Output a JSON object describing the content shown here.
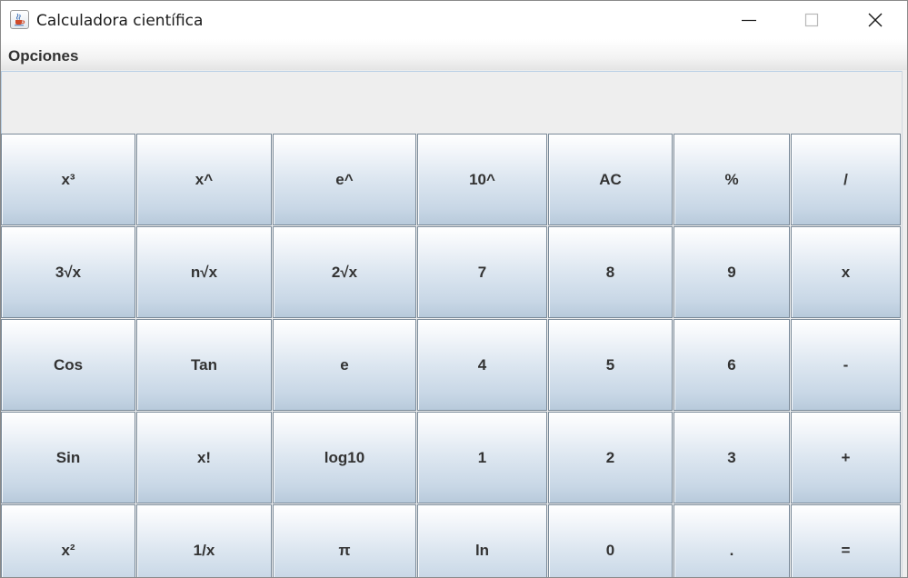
{
  "window": {
    "title": "Calculadora científica",
    "icon": "java-coffee-cup-icon",
    "controls": [
      "minimize-icon",
      "maximize-icon",
      "close-icon"
    ]
  },
  "menu": {
    "items": [
      "Opciones"
    ]
  },
  "display": {
    "value": ""
  },
  "keypad": {
    "rows": [
      [
        "x³",
        "x^",
        "e^",
        "10^",
        "AC",
        "%",
        "/"
      ],
      [
        "3√x",
        "n√x",
        "2√x",
        "7",
        "8",
        "9",
        "x"
      ],
      [
        "Cos",
        "Tan",
        "e",
        "4",
        "5",
        "6",
        "-"
      ],
      [
        "Sin",
        "x!",
        "log10",
        "1",
        "2",
        "3",
        "+"
      ],
      [
        "x²",
        "1/x",
        "π",
        "ln",
        "0",
        ".",
        "="
      ]
    ],
    "names": [
      [
        "key-cube",
        "key-power",
        "key-exp",
        "key-pow10",
        "key-all-clear",
        "key-percent",
        "key-divide"
      ],
      [
        "key-cube-root",
        "key-nth-root",
        "key-square-root",
        "key-7",
        "key-8",
        "key-9",
        "key-multiply"
      ],
      [
        "key-cos",
        "key-tan",
        "key-e",
        "key-4",
        "key-5",
        "key-6",
        "key-subtract"
      ],
      [
        "key-sin",
        "key-factorial",
        "key-log10",
        "key-1",
        "key-2",
        "key-3",
        "key-add"
      ],
      [
        "key-square",
        "key-reciprocal",
        "key-pi",
        "key-ln",
        "key-0",
        "key-decimal",
        "key-equals"
      ]
    ]
  },
  "colors": {
    "button_border": "#7a8a99",
    "button_text": "#333333",
    "display_bg": "#eeeeee",
    "display_border": "#b8cfe5"
  }
}
